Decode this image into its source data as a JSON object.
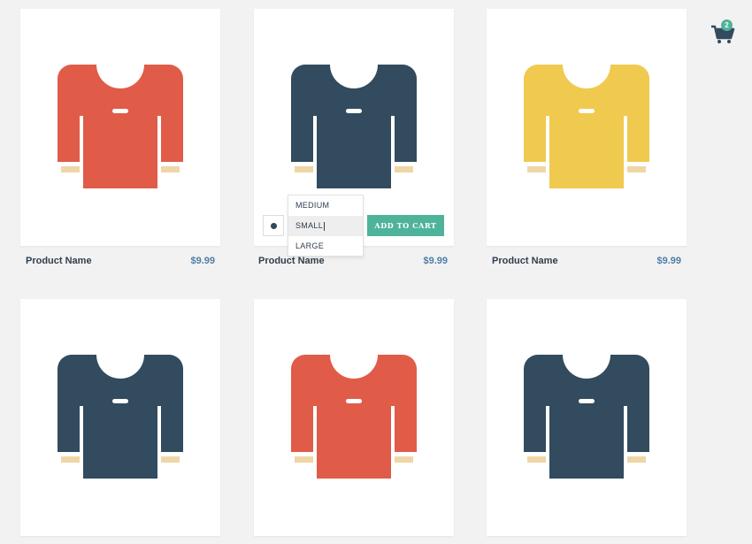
{
  "cart": {
    "icon": "shopping-cart-icon",
    "count": "2"
  },
  "products": [
    {
      "name": "Product Name",
      "price": "$9.99",
      "color": "#e05c48"
    },
    {
      "name": "Product Name",
      "price": "$9.99",
      "color": "#324b5e"
    },
    {
      "name": "Product Name",
      "price": "$9.99",
      "color": "#f0c94f"
    },
    {
      "color": "#324b5e"
    },
    {
      "color": "#e05c48"
    },
    {
      "color": "#324b5e"
    }
  ],
  "shirt_accent": {
    "cuff": "#efd6a6",
    "stripe": "#ffffff"
  },
  "options_panel": {
    "color_dot": "#2f4a5d",
    "size_options": [
      "MEDIUM",
      "SMALL",
      "LARGE"
    ],
    "selected_size": "SMALL",
    "add_to_cart_label": "ADD TO CART",
    "accent": "#4fb39a"
  }
}
